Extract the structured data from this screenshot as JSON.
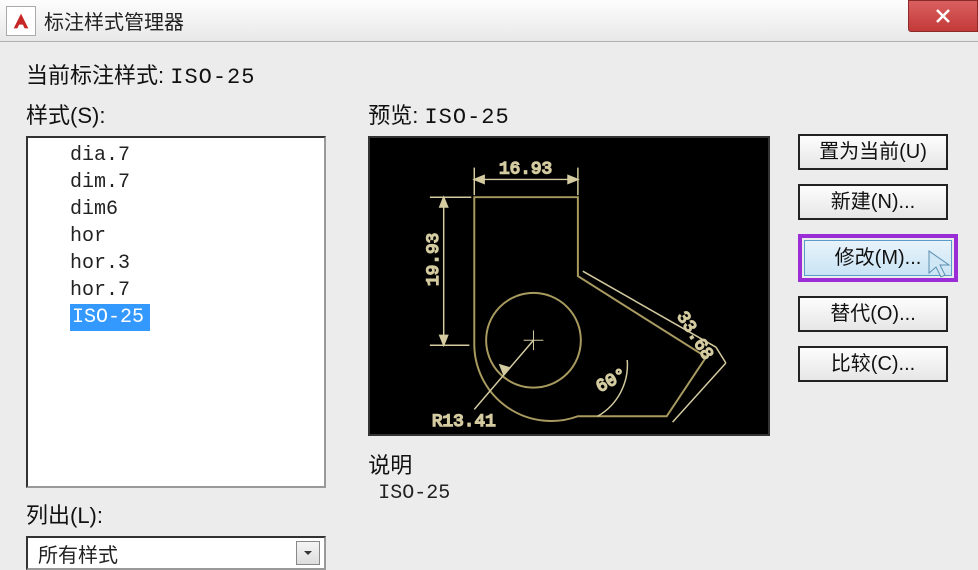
{
  "window": {
    "title": "标注样式管理器"
  },
  "current_style": {
    "label": "当前标注样式:",
    "value": "ISO-25"
  },
  "styles": {
    "label": "样式(S):",
    "items": [
      "dia.7",
      "dim.7",
      "dim6",
      "hor",
      "hor.3",
      "hor.7",
      "ISO-25"
    ],
    "selected_index": 6
  },
  "list_filter": {
    "label": "列出(L):",
    "value": "所有样式"
  },
  "preview": {
    "label": "预览:",
    "value": "ISO-25",
    "dims": {
      "top": "16.93",
      "left": "19.93",
      "diag": "33.68",
      "angle": "60°",
      "radius": "R13.41"
    }
  },
  "description": {
    "label": "说明",
    "value": "ISO-25"
  },
  "buttons": {
    "set_current": "置为当前(U)",
    "new": "新建(N)...",
    "modify": "修改(M)...",
    "override": "替代(O)...",
    "compare": "比较(C)..."
  }
}
